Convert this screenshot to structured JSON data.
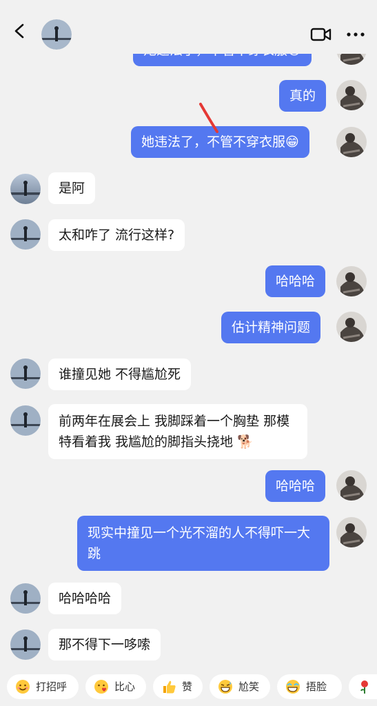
{
  "messages": [
    {
      "side": "me",
      "text": "她违法了，不管不穿衣服😁"
    },
    {
      "side": "me",
      "text": "真的"
    },
    {
      "side": "me",
      "text": "她违法了，不管不穿衣服😁"
    },
    {
      "side": "them",
      "text": "是阿"
    },
    {
      "side": "them",
      "text": "太和咋了 流行这样?"
    },
    {
      "side": "me",
      "text": "哈哈哈"
    },
    {
      "side": "me",
      "text": "估计精神问题"
    },
    {
      "side": "them",
      "text": "谁撞见她 不得尴尬死"
    },
    {
      "side": "them",
      "text": "前两年在展会上 我脚踩着一个胸垫 那模特看着我 我尴尬的脚指头挠地 🐕"
    },
    {
      "side": "me",
      "text": "哈哈哈"
    },
    {
      "side": "me",
      "text": "现实中撞见一个光不溜的人不得吓一大跳"
    },
    {
      "side": "them",
      "text": "哈哈哈哈"
    },
    {
      "side": "them",
      "text": "那不得下一哆嗦"
    }
  ],
  "quick_replies": [
    {
      "label": "打招呼",
      "icon": "smile-emoji-icon"
    },
    {
      "label": "比心",
      "icon": "heart-hand-emoji-icon"
    },
    {
      "label": "赞",
      "icon": "thumbs-up-icon"
    },
    {
      "label": "尬笑",
      "icon": "awkward-laugh-emoji-icon"
    },
    {
      "label": "捂脸",
      "icon": "facepalm-emoji-icon"
    }
  ],
  "colors": {
    "my_bubble": "#5478f0",
    "their_bubble": "#ffffff",
    "background": "#f1f1f1",
    "annotation": "#e53935"
  }
}
